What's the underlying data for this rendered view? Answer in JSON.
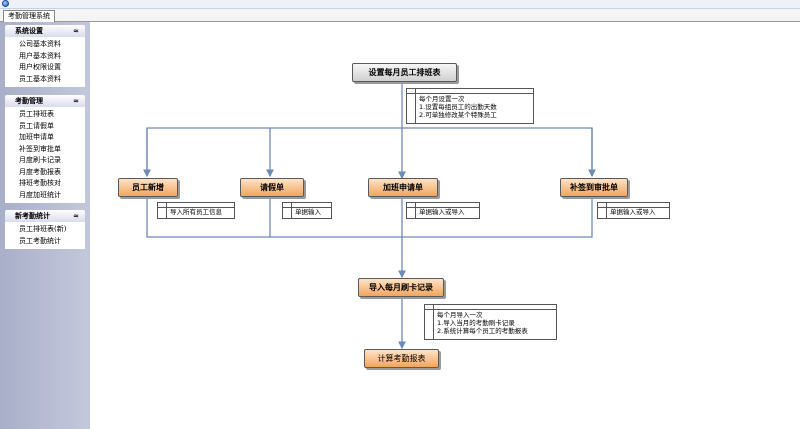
{
  "tab": {
    "label": "考勤管理系统"
  },
  "sidebar": {
    "sections": [
      {
        "title": "系统设置",
        "items": [
          "公司基本资料",
          "用户基本资料",
          "用户权限设置",
          "员工基本资料"
        ]
      },
      {
        "title": "考勤管理",
        "items": [
          "员工排班表",
          "员工请假单",
          "加班申请单",
          "补签到审批单",
          "月度刷卡记录",
          "月度考勤报表",
          "排班考勤核对",
          "月度加班统计"
        ]
      },
      {
        "title": "新考勤统计",
        "items": [
          "员工排班表(新)",
          "员工考勤统计"
        ]
      }
    ],
    "collapse_glyph": "≈"
  },
  "flow": {
    "start": "设置每月员工排班表",
    "start_note": [
      "每个月设置一次",
      "1.设置每组员工的出勤天数",
      "2.可单独修改某个特殊员工"
    ],
    "branches": [
      {
        "label": "员工新增",
        "note": "导入所有员工信息"
      },
      {
        "label": "请假单",
        "note": "单据输入"
      },
      {
        "label": "加班申请单",
        "note": "单据输入或导入"
      },
      {
        "label": "补签到审批单",
        "note": "单据输入或导入"
      }
    ],
    "import": "导入每月刷卡记录",
    "import_note": [
      "每个月导入一次",
      "1.导入当月的考勤刷卡记录",
      "2.系统计算每个员工的考勤报表"
    ],
    "final": "计算考勤报表"
  },
  "colors": {
    "arrow": "#6f8bb8",
    "sidebar": "#b3b8d1",
    "orange": "#f3a55c"
  }
}
